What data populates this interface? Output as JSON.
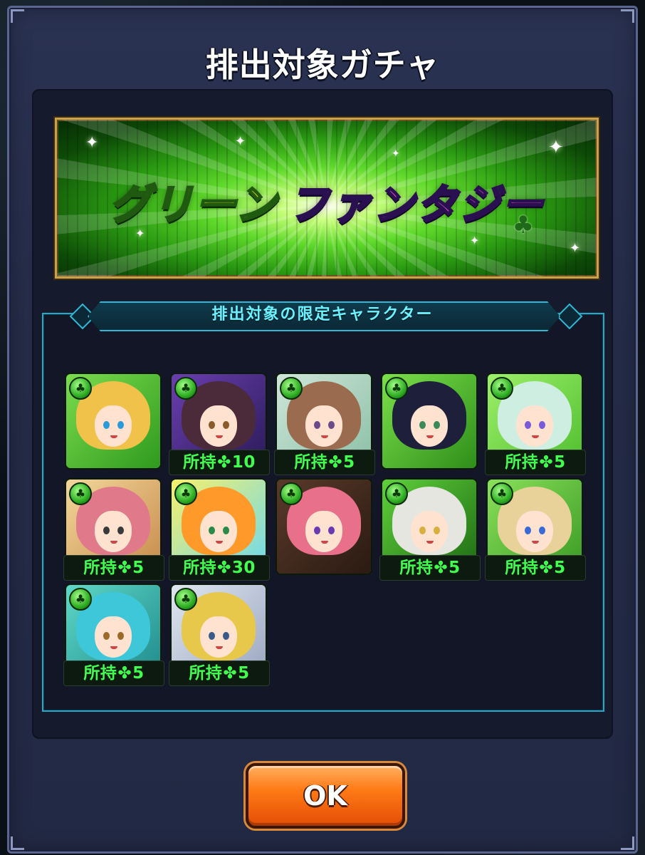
{
  "dialog": {
    "title": "排出対象ガチャ",
    "banner": {
      "title_part1": "グリーン",
      "title_part2": "ファンタジー",
      "clover_glyph": "♣"
    },
    "section_title": "排出対象の限定キャラクター",
    "owned_prefix": "所持",
    "clover_glyph": "✤",
    "characters": [
      {
        "owned": "",
        "theme": "blonde"
      },
      {
        "owned": "10",
        "theme": "purple-group"
      },
      {
        "owned": "5",
        "theme": "brown-hair"
      },
      {
        "owned": "",
        "theme": "dark-hair"
      },
      {
        "owned": "5",
        "theme": "mint-hair"
      },
      {
        "owned": "5",
        "theme": "food-group"
      },
      {
        "owned": "30",
        "theme": "orange-hair"
      },
      {
        "owned": "",
        "theme": "pink-hair"
      },
      {
        "owned": "5",
        "theme": "masked"
      },
      {
        "owned": "5",
        "theme": "blonde-boy"
      },
      {
        "owned": "5",
        "theme": "teal-hair"
      },
      {
        "owned": "5",
        "theme": "trio"
      }
    ],
    "ok_label": "OK"
  },
  "colors": {
    "accent_cyan": "#2fb8d4",
    "owned_green": "#41ff4e",
    "button_orange": "#ff7a16"
  }
}
